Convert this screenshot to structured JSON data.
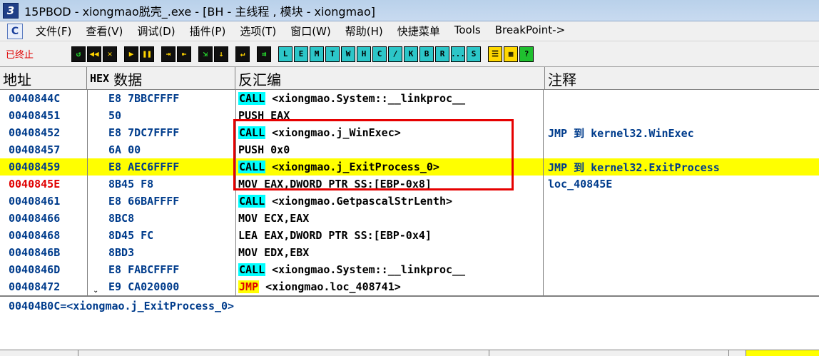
{
  "window": {
    "title": "15PBOD  - xiongmao脱壳_.exe - [BH - 主线程 , 模块 - xiongmao]",
    "logo": "3"
  },
  "menu": {
    "logo": "C",
    "items": [
      "文件(F)",
      "查看(V)",
      "调试(D)",
      "插件(P)",
      "选项(T)",
      "窗口(W)",
      "帮助(H)",
      "快捷菜单",
      "Tools",
      "BreakPoint->"
    ]
  },
  "toolbar": {
    "status": "已终止",
    "groups": [
      [
        {
          "g": "↺",
          "s": "tb-dark g"
        },
        {
          "g": "◀◀",
          "s": "tb-dark y"
        },
        {
          "g": "✕",
          "s": "tb-dark y"
        }
      ],
      [
        {
          "g": "▶",
          "s": "tb-dark y"
        },
        {
          "g": "❚❚",
          "s": "tb-dark y"
        }
      ],
      [
        {
          "g": "⇥",
          "s": "tb-dark y"
        },
        {
          "g": "⇤",
          "s": "tb-dark y"
        }
      ],
      [
        {
          "g": "⇲",
          "s": "tb-dark g"
        },
        {
          "g": "↓",
          "s": "tb-dark y"
        }
      ],
      [
        {
          "g": "↵",
          "s": "tb-dark y"
        }
      ],
      [
        {
          "g": "⇉",
          "s": "tb-dark g"
        }
      ],
      [
        {
          "g": "L",
          "s": "tb-cyan"
        },
        {
          "g": "E",
          "s": "tb-cyan"
        },
        {
          "g": "M",
          "s": "tb-cyan"
        },
        {
          "g": "T",
          "s": "tb-cyan"
        },
        {
          "g": "W",
          "s": "tb-cyan"
        },
        {
          "g": "H",
          "s": "tb-cyan"
        },
        {
          "g": "C",
          "s": "tb-cyan"
        },
        {
          "g": "/",
          "s": "tb-cyan"
        },
        {
          "g": "K",
          "s": "tb-cyan"
        },
        {
          "g": "B",
          "s": "tb-cyan"
        },
        {
          "g": "R",
          "s": "tb-cyan"
        },
        {
          "g": "...",
          "s": "tb-cyan"
        },
        {
          "g": "S",
          "s": "tb-cyan"
        }
      ],
      [
        {
          "g": "☰",
          "s": "tb-yellow"
        },
        {
          "g": "▦",
          "s": "tb-yellow"
        },
        {
          "g": "?",
          "s": "tb-green"
        }
      ]
    ]
  },
  "columns": {
    "addr": "地址",
    "hex_tag": "HEX",
    "hex": "数据",
    "disasm": "反汇编",
    "comment": "注释"
  },
  "rows": [
    {
      "addr": "0040844C",
      "hex": "E8 7BBCFFFF",
      "op": "CALL",
      "opk": "call",
      "arg": " <xiongmao.System::__linkproc__",
      "com": "",
      "cls": ""
    },
    {
      "addr": "00408451",
      "hex": "50",
      "op": "PUSH EAX",
      "opk": "",
      "arg": "",
      "com": "",
      "cls": ""
    },
    {
      "addr": "00408452",
      "hex": "E8 7DC7FFFF",
      "op": "CALL",
      "opk": "call",
      "arg": " <xiongmao.j_WinExec>",
      "com": "JMP 到 kernel32.WinExec",
      "cls": ""
    },
    {
      "addr": "00408457",
      "hex": "6A 00",
      "op": "PUSH 0x0",
      "opk": "",
      "arg": "",
      "com": "",
      "cls": ""
    },
    {
      "addr": "00408459",
      "hex": "E8 AEC6FFFF",
      "op": "CALL",
      "opk": "call",
      "arg": " <xiongmao.j_ExitProcess_0>",
      "com": "JMP 到 kernel32.ExitProcess",
      "cls": "cur"
    },
    {
      "addr": "0040845E",
      "hex": "8B45 F8",
      "op": "MOV EAX,DWORD PTR SS:[EBP-0x8]",
      "opk": "",
      "arg": "",
      "com": "loc_40845E",
      "cls": "jmpdest"
    },
    {
      "addr": "00408461",
      "hex": "E8 66BAFFFF",
      "op": "CALL",
      "opk": "call",
      "arg": " <xiongmao.GetpascalStrLenth>",
      "com": "",
      "cls": ""
    },
    {
      "addr": "00408466",
      "hex": "8BC8",
      "op": "MOV ECX,EAX",
      "opk": "",
      "arg": "",
      "com": "",
      "cls": ""
    },
    {
      "addr": "00408468",
      "hex": "8D45 FC",
      "op": "LEA EAX,DWORD PTR SS:[EBP-0x4]",
      "opk": "",
      "arg": "",
      "com": "",
      "cls": ""
    },
    {
      "addr": "0040846B",
      "hex": "8BD3",
      "op": "MOV EDX,EBX",
      "opk": "",
      "arg": "",
      "com": "",
      "cls": ""
    },
    {
      "addr": "0040846D",
      "hex": "E8 FABCFFFF",
      "op": "CALL",
      "opk": "call",
      "arg": " <xiongmao.System::__linkproc__",
      "com": "",
      "cls": ""
    },
    {
      "addr": "00408472",
      "hex": "E9 CA020000",
      "op": "JMP",
      "opk": "jmp",
      "arg": " <xiongmao.loc_408741>",
      "com": "",
      "cls": ""
    }
  ],
  "info": {
    "text": "00404B0C=<xiongmao.j_ExitProcess_0>"
  }
}
